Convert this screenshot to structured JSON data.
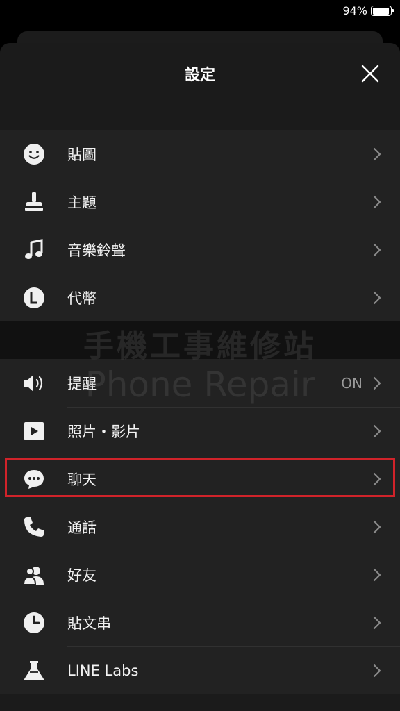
{
  "status_bar": {
    "battery_percent": "94%"
  },
  "header": {
    "title": "設定"
  },
  "sections": [
    {
      "items": [
        {
          "icon": "smiley-icon",
          "label": "貼圖"
        },
        {
          "icon": "paint-brush-icon",
          "label": "主題"
        },
        {
          "icon": "music-note-icon",
          "label": "音樂鈴聲"
        },
        {
          "icon": "coin-icon",
          "label": "代幣"
        }
      ]
    },
    {
      "items": [
        {
          "icon": "speaker-icon",
          "label": "提醒",
          "value": "ON"
        },
        {
          "icon": "play-icon",
          "label": "照片・影片"
        },
        {
          "icon": "chat-bubble-icon",
          "label": "聊天",
          "highlighted": true
        },
        {
          "icon": "phone-icon",
          "label": "通話"
        },
        {
          "icon": "friends-icon",
          "label": "好友"
        },
        {
          "icon": "clock-icon",
          "label": "貼文串"
        },
        {
          "icon": "flask-icon",
          "label": "LINE Labs"
        }
      ]
    }
  ],
  "watermark": {
    "line1": "手機工事維修站",
    "line2": "Phone Repair"
  },
  "colors": {
    "highlight": "#d0232a",
    "row_bg": "#222222",
    "sheet_bg": "#1b1b1b"
  }
}
